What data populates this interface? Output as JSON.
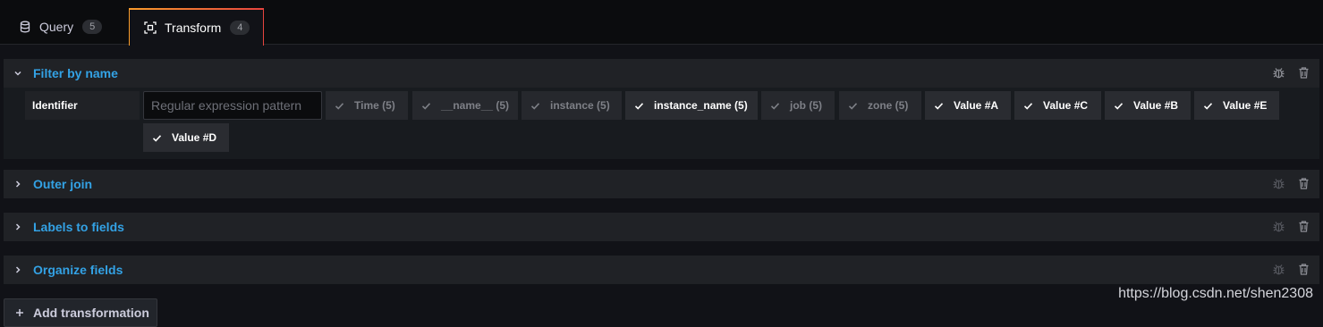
{
  "tabs": [
    {
      "label": "Query",
      "count": "5",
      "icon": "database-icon"
    },
    {
      "label": "Transform",
      "count": "4",
      "icon": "transform-icon"
    }
  ],
  "transformations": [
    {
      "title": "Filter by name",
      "expanded": true
    },
    {
      "title": "Outer join",
      "expanded": false
    },
    {
      "title": "Labels to fields",
      "expanded": false
    },
    {
      "title": "Organize fields",
      "expanded": false
    }
  ],
  "filter": {
    "identifier_label": "Identifier",
    "regex_placeholder": "Regular expression pattern",
    "regex_value": "",
    "fields": [
      {
        "label": "Time (5)",
        "selected": false
      },
      {
        "label": "__name__ (5)",
        "selected": false
      },
      {
        "label": "instance (5)",
        "selected": false
      },
      {
        "label": "instance_name (5)",
        "selected": true
      },
      {
        "label": "job (5)",
        "selected": false
      },
      {
        "label": "zone (5)",
        "selected": false
      },
      {
        "label": "Value #A",
        "selected": true
      },
      {
        "label": "Value #C",
        "selected": true
      },
      {
        "label": "Value #B",
        "selected": true
      },
      {
        "label": "Value #E",
        "selected": true
      },
      {
        "label": "Value #D",
        "selected": true
      }
    ]
  },
  "add_button_label": "Add transformation",
  "watermark": "https://blog.csdn.net/shen2308",
  "colors": {
    "accent": "#33a2e5",
    "tab_gradient_start": "#f99c2b",
    "tab_gradient_end": "#e6443e"
  }
}
